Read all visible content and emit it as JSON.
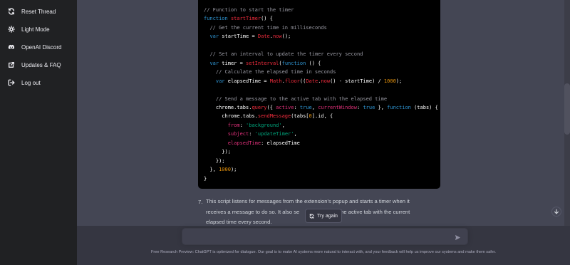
{
  "sidebar": {
    "items": [
      {
        "label": "Reset Thread",
        "icon": "refresh-icon"
      },
      {
        "label": "Light Mode",
        "icon": "sun-icon"
      },
      {
        "label": "OpenAI Discord",
        "icon": "discord-icon"
      },
      {
        "label": "Updates & FAQ",
        "icon": "external-link-icon"
      },
      {
        "label": "Log out",
        "icon": "logout-icon"
      }
    ]
  },
  "message": {
    "list_number": "7.",
    "paragraph_lines": [
      "This script listens for messages from the extension's popup and starts a timer when it",
      "receives a message to do so. It also se",
      "elapsed time every second."
    ],
    "paragraph_line2_tail": "e to the active tab with the current"
  },
  "code": {
    "language": "javascript"
  },
  "try_again": {
    "label": "Try again"
  },
  "input": {
    "value": "",
    "placeholder": ""
  },
  "footer": {
    "text": "Free Research Preview: ChatGPT is optimized for dialogue. Our goal is to make AI systems more natural to interact with, and your feedback will help us improve our systems and make them safer."
  },
  "colors": {
    "sidebar_bg": "#202123",
    "main_bg": "#444654",
    "code_bg": "#000000",
    "comment": "#9b9ba5",
    "keyword": "#2e95d3",
    "function": "#f22c3d",
    "property": "#df3079",
    "string": "#00a67d",
    "number": "#e9950c"
  }
}
